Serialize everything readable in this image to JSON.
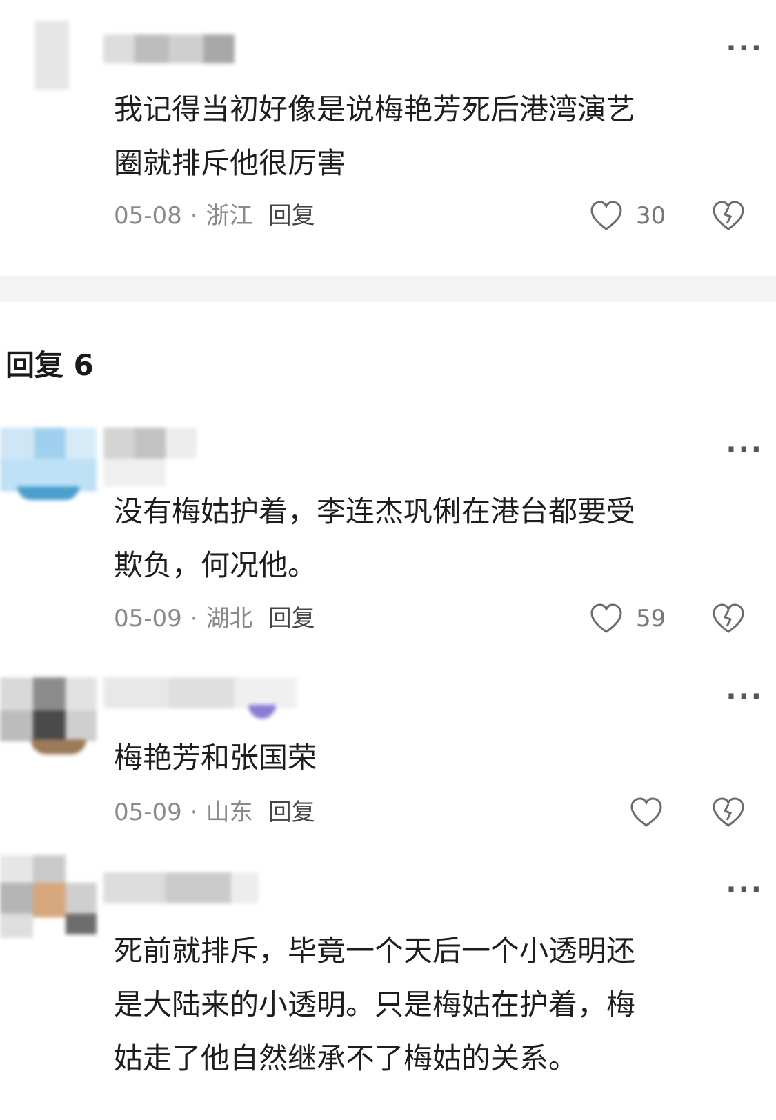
{
  "section": {
    "title": "回复 6"
  },
  "comments": [
    {
      "text_lines": [
        "我记得当初好像是说梅艳芳死后港湾演艺",
        "圈就排斥他很厉害"
      ],
      "date": "05-08",
      "region": "浙江",
      "reply_label": "回复",
      "likes": "30"
    },
    {
      "text_lines": [
        "没有梅姑护着，李连杰巩俐在港台都要受",
        "欺负，何况他。"
      ],
      "date": "05-09",
      "region": "湖北",
      "reply_label": "回复",
      "likes": "59"
    },
    {
      "text_lines": [
        "梅艳芳和张国荣"
      ],
      "date": "05-09",
      "region": "山东",
      "reply_label": "回复",
      "likes": ""
    },
    {
      "text_lines": [
        "死前就排斥，毕竟一个天后一个小透明还",
        "是大陆来的小透明。只是梅姑在护着，梅",
        "姑走了他自然继承不了梅姑的关系。"
      ]
    }
  ],
  "icons": {
    "more": "more-dots-icon",
    "like": "heart-icon",
    "dislike": "broken-heart-icon"
  },
  "more_glyph": "···",
  "colors": {
    "background": "#ffffff",
    "divider": "#f3f3f4",
    "meta_text": "#8a8a8a"
  }
}
